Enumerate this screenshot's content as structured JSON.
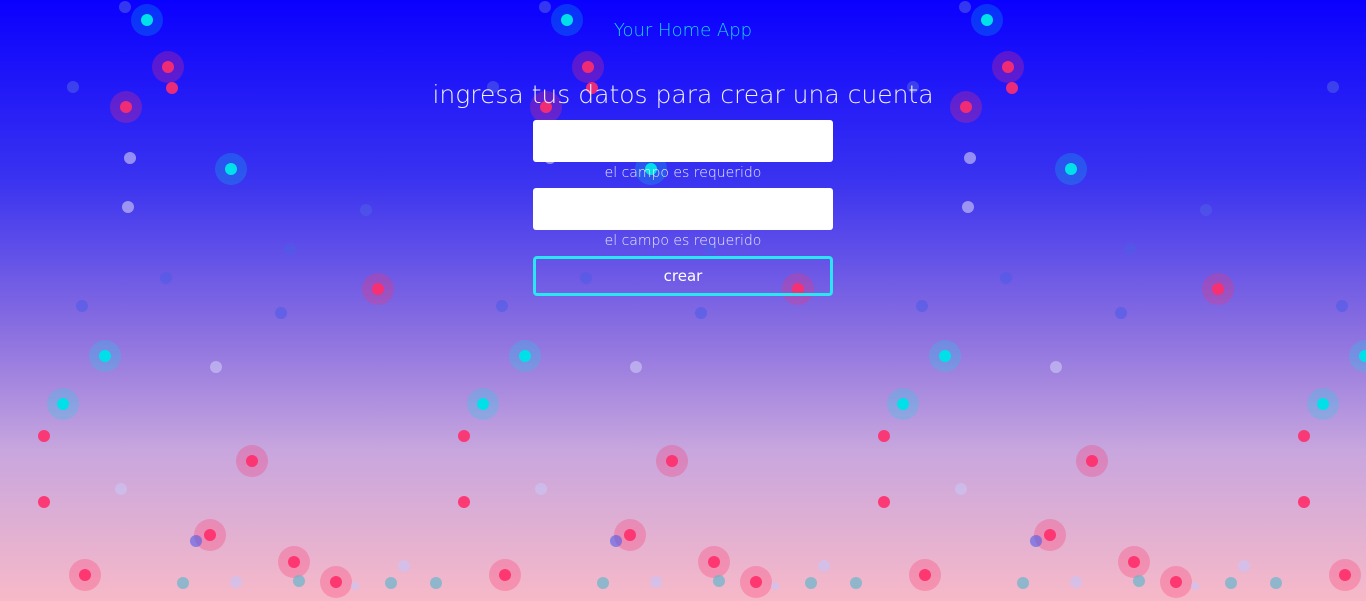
{
  "app": {
    "title": "Your Home App"
  },
  "form": {
    "heading": "ingresa tus datos para crear una cuenta",
    "field1": {
      "value": "",
      "placeholder": "",
      "error": "el campo es requerido"
    },
    "field2": {
      "value": "",
      "placeholder": "",
      "error": "el campo es requerido"
    },
    "submit_label": "crear"
  },
  "colors": {
    "background_top": "#0a00ff",
    "background_bottom": "#f7b9c8",
    "accent_cyan": "#1ad8ea",
    "bubble_pink": "#ff2d6a",
    "bubble_cyan": "#00e0e8",
    "bubble_lilac": "#c9c3f5"
  },
  "background_pattern": "floating-bubbles"
}
